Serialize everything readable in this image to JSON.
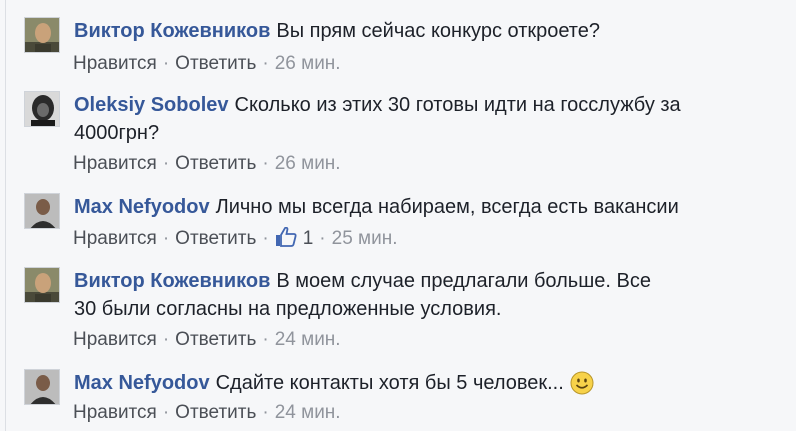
{
  "comments": [
    {
      "author": "Виктор Кожевников",
      "text": "Вы прям сейчас конкурс откроете?",
      "actions": {
        "like": "Нравится",
        "reply": "Ответить",
        "time": "26 мин."
      },
      "avatar_icon": "portrait-avatar-icon"
    },
    {
      "author": "Oleksiy Sobolev",
      "text": "Сколько из этих 30 готовы идти на госслужбу за 4000грн?",
      "actions": {
        "like": "Нравится",
        "reply": "Ответить",
        "time": "26 мин."
      },
      "avatar_icon": "portrait-avatar-icon"
    },
    {
      "author": "Max Nefyodov",
      "text": "Лично мы всегда набираем, всегда есть вакансии",
      "actions": {
        "like": "Нравится",
        "reply": "Ответить",
        "likes_count": "1",
        "time": "25 мин."
      },
      "avatar_icon": "portrait-avatar-icon",
      "reaction_icon": "thumbs-up-icon"
    },
    {
      "author": "Виктор Кожевников",
      "text": "В моем случае предлагали больше. Все 30 были согласны на предложенные условия.",
      "actions": {
        "like": "Нравится",
        "reply": "Ответить",
        "time": "24 мин."
      },
      "avatar_icon": "portrait-avatar-icon"
    },
    {
      "author": "Max Nefyodov",
      "text": "Сдайте контакты хотя бы 5 человек...",
      "actions": {
        "like": "Нравится",
        "reply": "Ответить",
        "time": "24 мин."
      },
      "avatar_icon": "portrait-avatar-icon",
      "emoji_icon": "smiley-emoji-icon"
    }
  ],
  "separator": "·",
  "colors": {
    "background": "#f6f7f9",
    "author_link": "#365899",
    "text": "#1d2129",
    "meta": "#90949c",
    "action": "#4b4f56",
    "like_blue": "#4267b2"
  }
}
